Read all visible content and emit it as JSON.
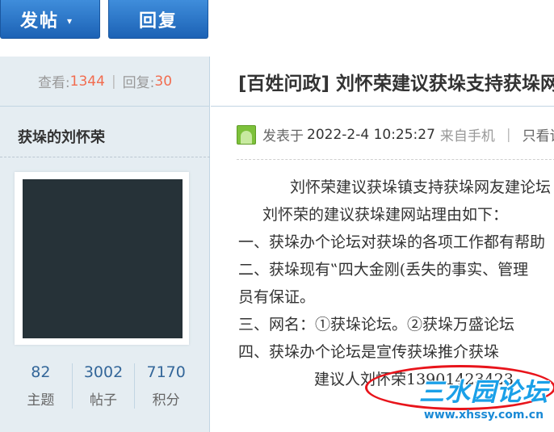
{
  "toolbar": {
    "post_label": "发帖",
    "post_caret": "▾",
    "reply_label": "回复"
  },
  "thread_stats": {
    "views_label": "查看:",
    "views_value": "1344",
    "separator": "|",
    "replies_label": "回复:",
    "replies_value": "30"
  },
  "author": {
    "name": "获垛的刘怀荣",
    "stats": [
      {
        "value": "82",
        "label": "主题"
      },
      {
        "value": "3002",
        "label": "帖子"
      },
      {
        "value": "7170",
        "label": "积分"
      }
    ]
  },
  "post": {
    "title": "[百姓问政] 刘怀荣建议获垛支持获垛网友建论坛",
    "meta_prefix": "发表于",
    "date": "2022-2-4 10:25:27",
    "source": "来自手机",
    "meta_sep": "|",
    "meta_tail": "只看该作者",
    "lines": [
      "刘怀荣建议获垛镇支持获垛网友建论坛",
      "刘怀荣的建议获垛建网站理由如下：",
      "一、获垛办个论坛对获垛的各项工作都有帮助",
      "二、获垛现有‟四大金刚(丢失的事实、管理",
      "员有保证。",
      "三、网名：①获垛论坛。②获垛万盛论坛",
      "四、获垛办个论坛是宣传获垛推介获垛",
      "建议人刘怀荣13901423423"
    ]
  },
  "watermark": {
    "brand": "三水园论坛",
    "url": "www.xhssy.com.cn"
  },
  "colors": {
    "button_blue": "#2b74c9",
    "number_orange": "#f26c4f",
    "stat_blue": "#336699",
    "sidebar_bg": "#e5edf2",
    "annotation_red": "#e8141b",
    "watermark_blue": "#1aa0e8"
  },
  "icons": {
    "post_caret": "chevron-down-icon",
    "meta_icon": "user-avatar-icon"
  }
}
